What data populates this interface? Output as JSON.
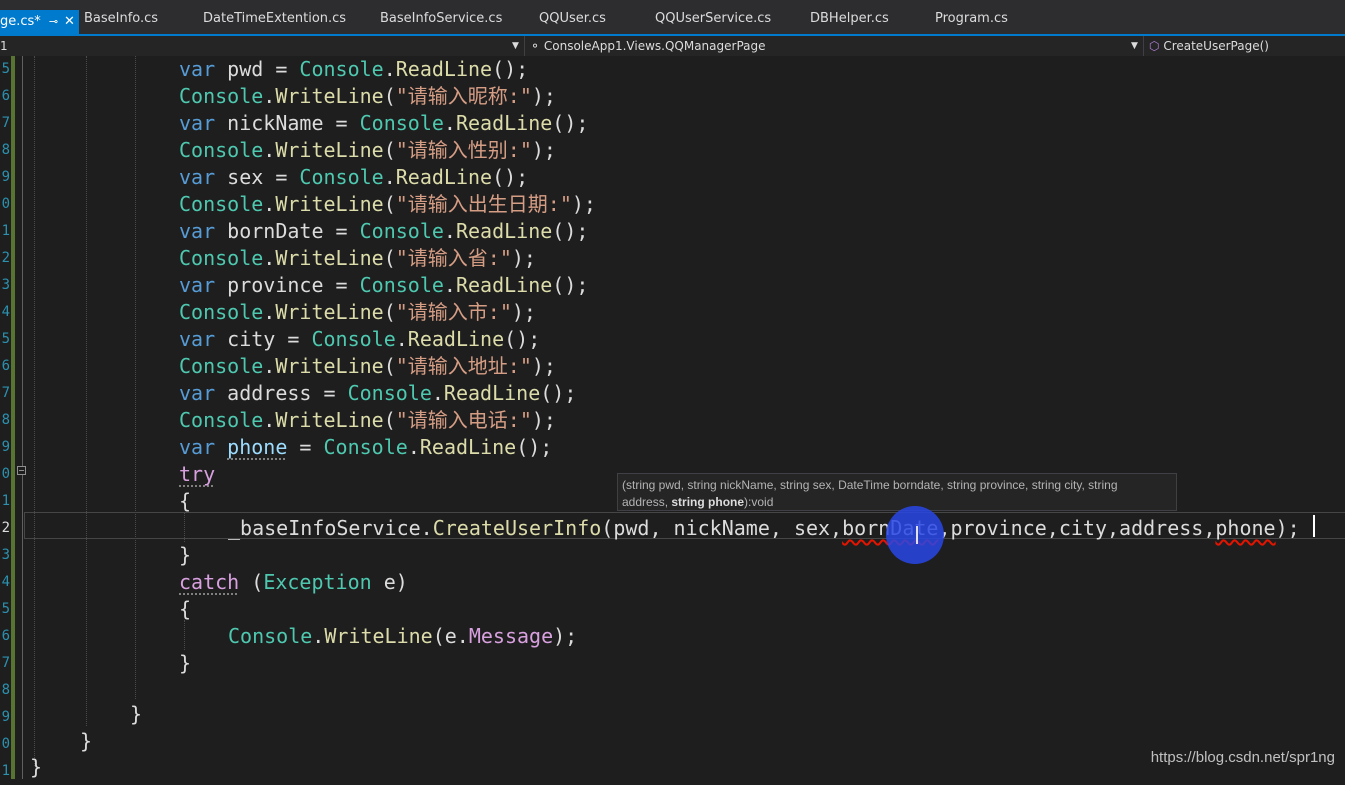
{
  "tabs": [
    {
      "label": "ge.cs*",
      "active": true,
      "pin_icon": "pin-icon",
      "close_icon": "close-icon"
    },
    {
      "label": "BaseInfo.cs"
    },
    {
      "label": "DateTimeExtention.cs"
    },
    {
      "label": "BaseInfoService.cs"
    },
    {
      "label": "QQUser.cs"
    },
    {
      "label": "QQUserService.cs"
    },
    {
      "label": "DBHelper.cs"
    },
    {
      "label": "Program.cs"
    }
  ],
  "nav": {
    "project": "1",
    "class": "ConsoleApp1.Views.QQManagerPage",
    "member": "CreateUserPage()",
    "class_icon": "class-icon",
    "member_icon": "method-icon"
  },
  "line_numbers": [
    "5",
    "6",
    "7",
    "8",
    "9",
    "0",
    "1",
    "2",
    "3",
    "4",
    "5",
    "6",
    "7",
    "8",
    "9",
    "0",
    "1",
    "2",
    "3",
    "4",
    "5",
    "6",
    "7",
    "8",
    "9",
    "0",
    "1"
  ],
  "code": {
    "l1": {
      "a": "var",
      "b": " pwd = ",
      "c": "Console",
      "d": ".",
      "e": "ReadLine",
      "f": "();"
    },
    "l2": {
      "a": "Console",
      "b": ".",
      "c": "WriteLine",
      "d": "(",
      "e": "\"请输入昵称:\"",
      "f": ");"
    },
    "l3": {
      "a": "var",
      "b": " nickName = ",
      "c": "Console",
      "d": ".",
      "e": "ReadLine",
      "f": "();"
    },
    "l4": {
      "a": "Console",
      "b": ".",
      "c": "WriteLine",
      "d": "(",
      "e": "\"请输入性别:\"",
      "f": ");"
    },
    "l5": {
      "a": "var",
      "b": " sex = ",
      "c": "Console",
      "d": ".",
      "e": "ReadLine",
      "f": "();"
    },
    "l6": {
      "a": "Console",
      "b": ".",
      "c": "WriteLine",
      "d": "(",
      "e": "\"请输入出生日期:\"",
      "f": ");"
    },
    "l7": {
      "a": "var",
      "b": " bornDate = ",
      "c": "Console",
      "d": ".",
      "e": "ReadLine",
      "f": "();"
    },
    "l8": {
      "a": "Console",
      "b": ".",
      "c": "WriteLine",
      "d": "(",
      "e": "\"请输入省:\"",
      "f": ");"
    },
    "l9": {
      "a": "var",
      "b": " province = ",
      "c": "Console",
      "d": ".",
      "e": "ReadLine",
      "f": "();"
    },
    "l10": {
      "a": "Console",
      "b": ".",
      "c": "WriteLine",
      "d": "(",
      "e": "\"请输入市:\"",
      "f": ");"
    },
    "l11": {
      "a": "var",
      "b": " city = ",
      "c": "Console",
      "d": ".",
      "e": "ReadLine",
      "f": "();"
    },
    "l12": {
      "a": "Console",
      "b": ".",
      "c": "WriteLine",
      "d": "(",
      "e": "\"请输入地址:\"",
      "f": ");"
    },
    "l13": {
      "a": "var",
      "b": " address = ",
      "c": "Console",
      "d": ".",
      "e": "ReadLine",
      "f": "();"
    },
    "l14": {
      "a": "Console",
      "b": ".",
      "c": "WriteLine",
      "d": "(",
      "e": "\"请输入电话:\"",
      "f": ");"
    },
    "l15": {
      "a": "var",
      "b": " ",
      "c": "phone",
      "d": " = ",
      "e": "Console",
      "f": ".",
      "g": "ReadLine",
      "h": "();"
    },
    "l16": {
      "a": "try"
    },
    "l17": {
      "a": "{"
    },
    "l18": {
      "a": "_baseInfoService",
      "b": ".",
      "c": "CreateUserInfo",
      "d": "(pwd, nickName, sex,",
      "e": "bornDate",
      "f": ",province,city,address,",
      "g": "phone",
      "h": ");"
    },
    "l19": {
      "a": "}"
    },
    "l20": {
      "a": "catch",
      "b": " (",
      "c": "Exception",
      "d": " e)"
    },
    "l21": {
      "a": "{"
    },
    "l22": {
      "a": "Console",
      "b": ".",
      "c": "WriteLine",
      "d": "(e.",
      "e": "Message",
      "f": ");"
    },
    "l23": {
      "a": "}"
    },
    "l25": {
      "a": "}"
    },
    "l26": {
      "a": "}"
    },
    "l27": {
      "a": "}"
    }
  },
  "tooltip": {
    "line1": "(string pwd, string nickName, string sex, DateTime borndate, string province, string city, string",
    "line2a": "address, ",
    "line2b": "string phone",
    "line2c": "):void"
  },
  "watermark": "https://blog.csdn.net/spr1ng",
  "colors": {
    "accent": "#007acc",
    "keyword": "#569cd6",
    "type": "#4ec9b0",
    "method": "#dcdcaa",
    "string": "#d69d85",
    "error_squiggle": "#e51400",
    "cursor_highlight": "#2846e6"
  }
}
